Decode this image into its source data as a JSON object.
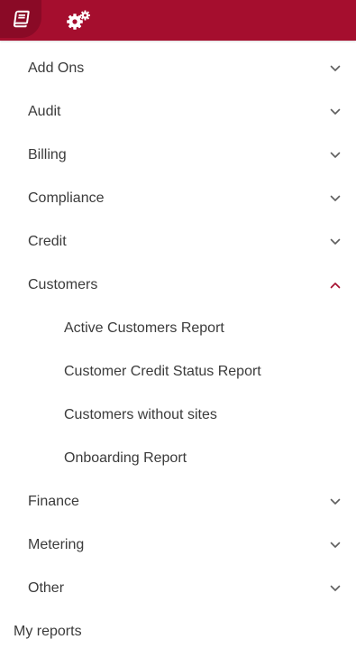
{
  "colors": {
    "topbar_bg": "#a50e2e",
    "active_tab_bg": "#8a0a26",
    "chevron_default": "#5f5f5f",
    "chevron_expanded": "#a50e2e",
    "text": "#3b3b3b"
  },
  "topbar": {
    "tabs": [
      {
        "icon": "book-icon",
        "active": true
      },
      {
        "icon": "gears-icon",
        "active": false
      }
    ]
  },
  "menu": {
    "categories": [
      {
        "label": "Add Ons",
        "expanded": false
      },
      {
        "label": "Audit",
        "expanded": false
      },
      {
        "label": "Billing",
        "expanded": false
      },
      {
        "label": "Compliance",
        "expanded": false
      },
      {
        "label": "Credit",
        "expanded": false
      },
      {
        "label": "Customers",
        "expanded": true,
        "items": [
          {
            "label": "Active Customers Report"
          },
          {
            "label": "Customer Credit Status Report"
          },
          {
            "label": "Customers without sites"
          },
          {
            "label": "Onboarding Report"
          }
        ]
      },
      {
        "label": "Finance",
        "expanded": false
      },
      {
        "label": "Metering",
        "expanded": false
      },
      {
        "label": "Other",
        "expanded": false
      }
    ],
    "my_reports": "My reports"
  }
}
